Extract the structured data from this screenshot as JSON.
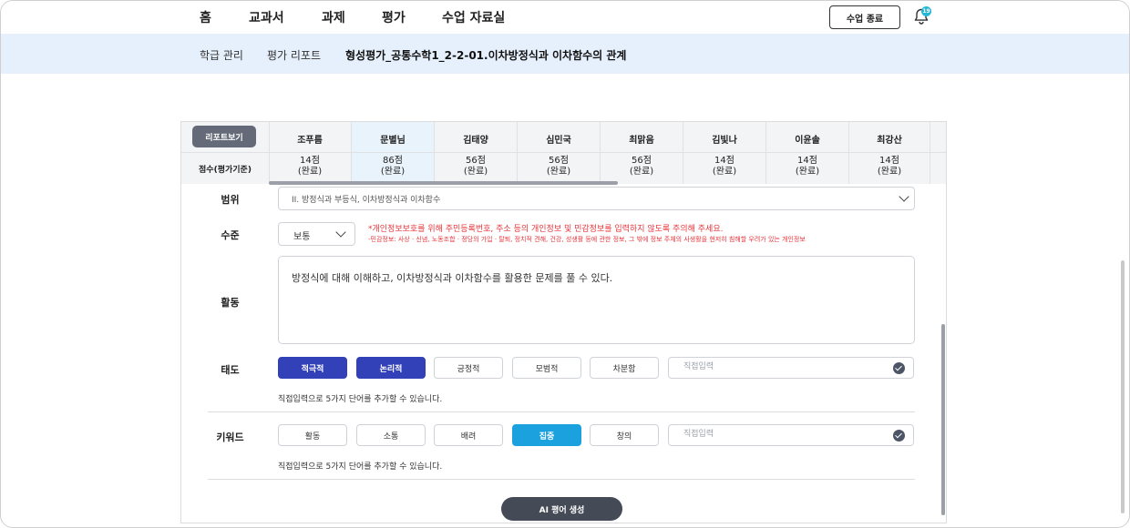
{
  "topnav": {
    "items": [
      "홈",
      "교과서",
      "과제",
      "평가",
      "수업 자료실"
    ],
    "end_class_label": "수업 종료",
    "notification_count": "19"
  },
  "subnav": {
    "items": [
      "학급 관리",
      "평가 리포트"
    ],
    "title": "형성평가_공통수학1_2-2-01.이차방정식과 이차함수의 관계"
  },
  "student_table": {
    "report_button_label": "리포트보기",
    "score_header": "점수(평가기준)",
    "students": [
      {
        "name": "조푸름",
        "score": "14점",
        "status": "(완료)"
      },
      {
        "name": "문별님",
        "score": "86점",
        "status": "(완료)"
      },
      {
        "name": "김태양",
        "score": "56점",
        "status": "(완료)"
      },
      {
        "name": "심민국",
        "score": "56점",
        "status": "(완료)"
      },
      {
        "name": "최맑음",
        "score": "56점",
        "status": "(완료)"
      },
      {
        "name": "김빛나",
        "score": "14점",
        "status": "(완료)"
      },
      {
        "name": "이윤솔",
        "score": "14점",
        "status": "(완료)"
      },
      {
        "name": "최강산",
        "score": "14점",
        "status": "(완료)"
      }
    ],
    "selected_student": "문별님"
  },
  "form": {
    "range": {
      "label": "범위",
      "value": "II. 방정식과 부등식, 이차방정식과 이차함수"
    },
    "level": {
      "label": "수준",
      "value": "보통",
      "warning": "*개인정보보호를 위해 주민등록번호, 주소 등의 개인정보 및 민감정보를 입력하지 않도록 주의해 주세요.",
      "warning_detail": "-민감정보: 사상 · 신념, 노동조합 · 정당의 가입 · 탈퇴, 정치적 견해, 건강, 성생활 등에 관한 정보, 그 밖에 정보 주체의 사생활을 현저히 침해할 우려가 있는 개인정보"
    },
    "activity": {
      "label": "활동",
      "value": "방정식에 대해 이해하고, 이차방정식과 이차함수를 활용한 문제를 풀 수 있다."
    },
    "attitude": {
      "label": "태도",
      "chips": [
        {
          "text": "적극적",
          "selected": true
        },
        {
          "text": "논리적",
          "selected": true
        },
        {
          "text": "긍정적",
          "selected": false
        },
        {
          "text": "모범적",
          "selected": false
        },
        {
          "text": "차분함",
          "selected": false
        }
      ],
      "direct_placeholder": "직접입력",
      "hint": "직접입력으로 5가지 단어를 추가할 수 있습니다."
    },
    "keyword": {
      "label": "키워드",
      "chips": [
        {
          "text": "활동",
          "selected": false
        },
        {
          "text": "소통",
          "selected": false
        },
        {
          "text": "배려",
          "selected": false
        },
        {
          "text": "집중",
          "selected": true
        },
        {
          "text": "창의",
          "selected": false
        }
      ],
      "direct_placeholder": "직접입력",
      "hint": "직접입력으로 5가지 단어를 추가할 수 있습니다."
    },
    "ai_button_label": "AI 평어 생성"
  },
  "colors": {
    "accent_blue": "#3341b8",
    "accent_cyan": "#1ba2de",
    "warning_red": "#e8343a",
    "subnav_bg": "#e6f0fc",
    "badge": "#25b8d6"
  }
}
